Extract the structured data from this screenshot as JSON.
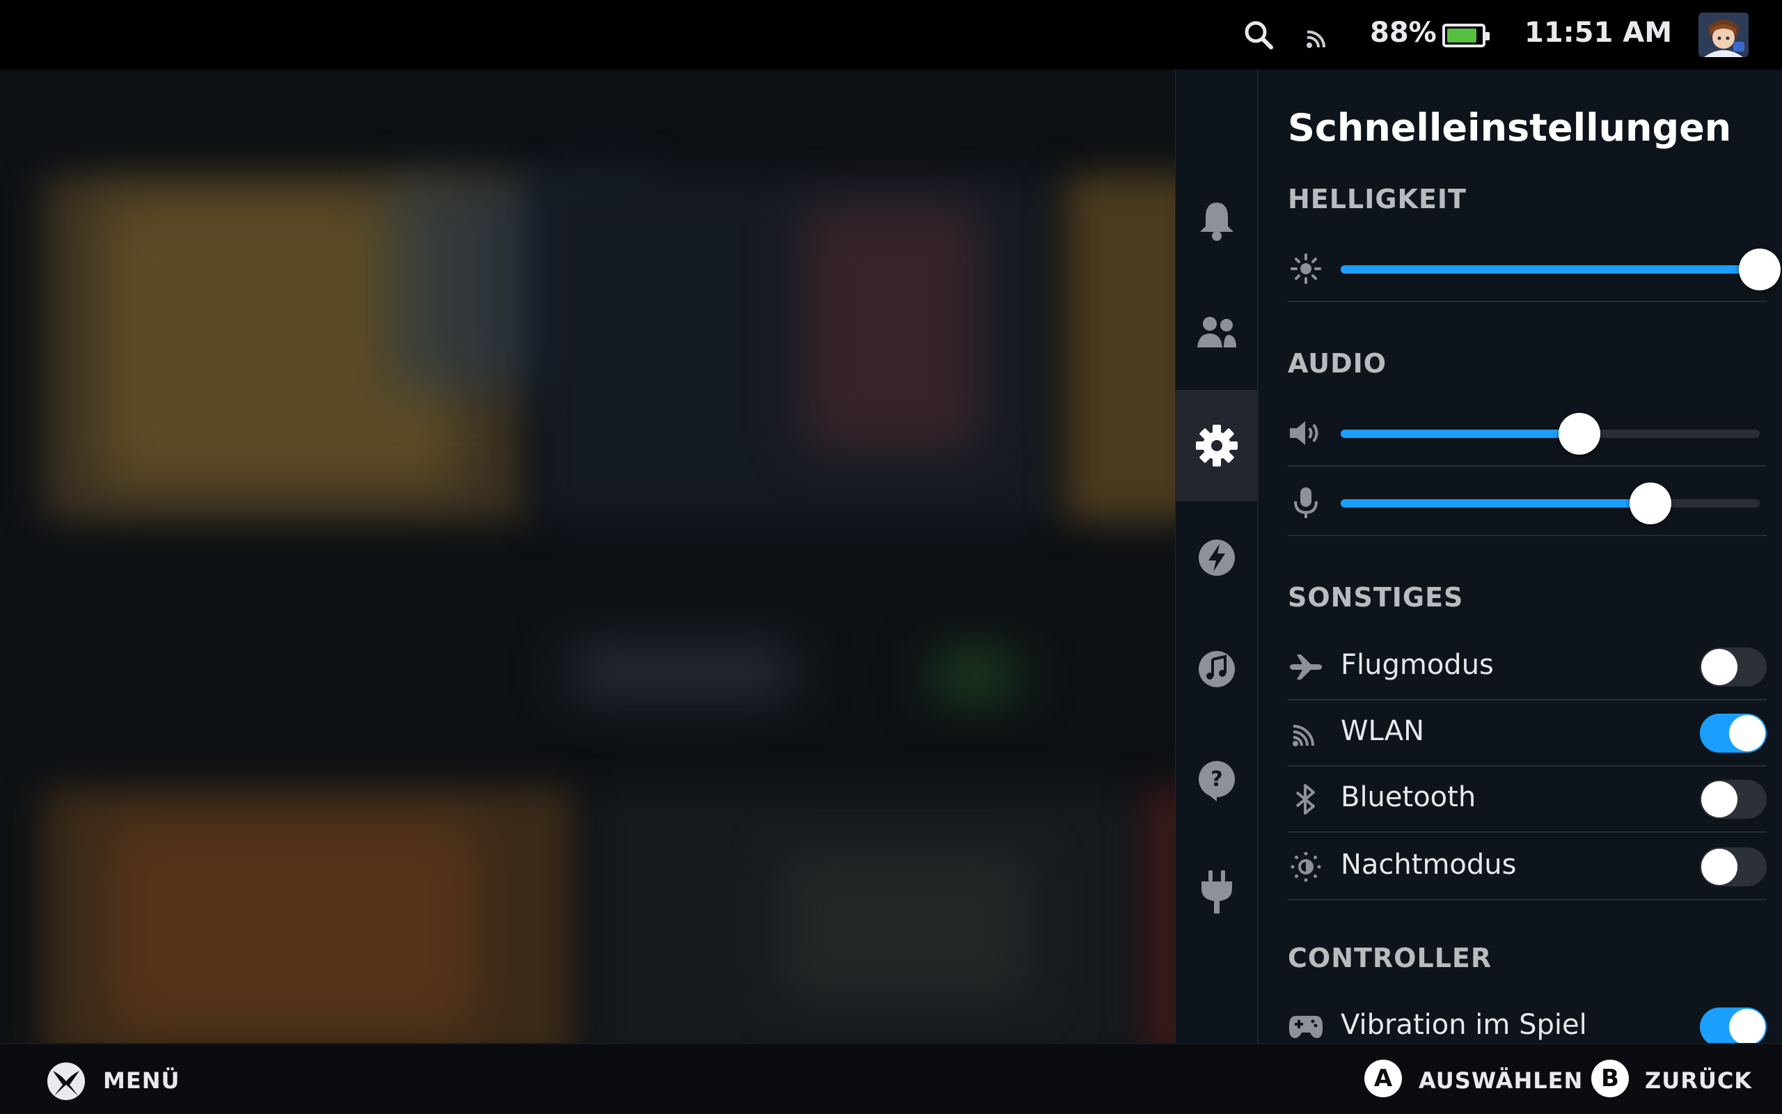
{
  "status_bar": {
    "icons": [
      "search-icon",
      "wifi-icon",
      "battery-icon",
      "avatar"
    ],
    "battery_percent": "88%",
    "battery_level": 0.88,
    "battery_color": "#59bf40",
    "time": "11:51 AM"
  },
  "rail": {
    "items": [
      "bell-icon",
      "friends-icon",
      "gear-icon",
      "lightning-icon",
      "music-icon",
      "help-icon",
      "plug-icon"
    ],
    "active": "gear-icon"
  },
  "quick_settings": {
    "title": "Schnelleinstellungen",
    "brightness": {
      "heading": "HELLIGKEIT",
      "icon": "sun-icon",
      "value": 1.0
    },
    "audio": {
      "heading": "AUDIO",
      "volume": {
        "icon": "speaker-icon",
        "value": 0.57
      },
      "microphone": {
        "icon": "microphone-icon",
        "value": 0.74
      }
    },
    "misc": {
      "heading": "SONSTIGES",
      "items": [
        {
          "label": "Flugmodus",
          "icon": "airplane-icon",
          "on": false
        },
        {
          "label": "WLAN",
          "icon": "wifi-icon",
          "on": true
        },
        {
          "label": "Bluetooth",
          "icon": "bluetooth-icon",
          "on": false
        },
        {
          "label": "Nachtmodus",
          "icon": "night-mode-icon",
          "on": false
        }
      ]
    },
    "controller": {
      "heading": "CONTROLLER",
      "items": [
        {
          "label": "Vibration im Spiel",
          "icon": "gamepad-icon",
          "on": true
        }
      ]
    },
    "accent_color": "#1a9fff"
  },
  "bottom_bar": {
    "menu_label": "MENÜ",
    "select_key": "A",
    "select_label": "AUSWÄHLEN",
    "back_key": "B",
    "back_label": "ZURÜCK"
  }
}
